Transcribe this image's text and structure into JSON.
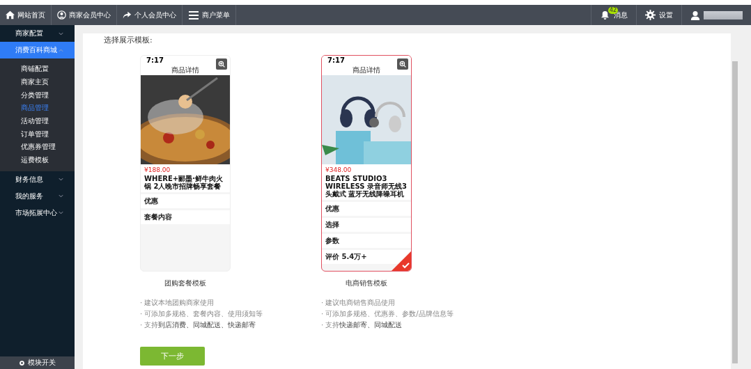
{
  "topbar": {
    "nav": [
      {
        "kind": "home",
        "label": "网站首页"
      },
      {
        "kind": "user-circle",
        "label": "商家会员中心"
      },
      {
        "kind": "share",
        "label": "个人会员中心"
      },
      {
        "kind": "menu",
        "label": "商户菜单"
      }
    ],
    "messages": {
      "label": "消息",
      "count": "42"
    },
    "settings": {
      "label": "设置"
    }
  },
  "sidebar": {
    "groups": [
      {
        "label": "商家配置",
        "expanded": false,
        "selected": false
      },
      {
        "label": "消费百科商城",
        "expanded": true,
        "selected": true,
        "children": [
          {
            "label": "商铺配置",
            "selected": false
          },
          {
            "label": "商家主页",
            "selected": false
          },
          {
            "label": "分类管理",
            "selected": false
          },
          {
            "label": "商品管理",
            "selected": true
          },
          {
            "label": "活动管理",
            "selected": false
          },
          {
            "label": "订单管理",
            "selected": false
          },
          {
            "label": "优惠券管理",
            "selected": false
          },
          {
            "label": "运费模板",
            "selected": false
          }
        ]
      },
      {
        "label": "财务信息",
        "expanded": false,
        "selected": false
      },
      {
        "label": "我的服务",
        "expanded": false,
        "selected": false
      },
      {
        "label": "市场拓展中心",
        "expanded": false,
        "selected": false
      }
    ],
    "footer": "模块开关"
  },
  "content": {
    "heading": "选择展示模板:",
    "templates": [
      {
        "name": "团购套餐模板",
        "selected": false,
        "kind": "food",
        "preview": {
          "time": "7:17",
          "title": "商品详情",
          "price": "¥188.00",
          "product": "WHERE+郦墨·鲜牛肉火锅 2人晚市招牌畅享套餐",
          "sections": [
            "优惠",
            "套餐内容"
          ]
        },
        "notes": [
          "· 建议本地团购商家使用",
          "· 可添加多规格、套餐内容、使用须知等",
          "· 支持**到店消费、同城配送、快递邮寄**"
        ]
      },
      {
        "name": "电商销售模板",
        "selected": true,
        "kind": "headphones",
        "preview": {
          "time": "7:17",
          "title": "商品详情",
          "price": "¥348.00",
          "product": "BEATS STUDIO3 WIRELESS 录音师无线3 头戴式 蓝牙无线降噪耳机",
          "sections": [
            "优惠",
            "选择",
            "参数",
            "评价 5.4万+"
          ]
        },
        "notes": [
          "· 建议电商销售商品使用",
          "· 可添加多规格、优惠券、参数/品牌信息等",
          "· 支持**快递邮寄、同城配送**"
        ]
      }
    ],
    "next_button": "下一步"
  }
}
